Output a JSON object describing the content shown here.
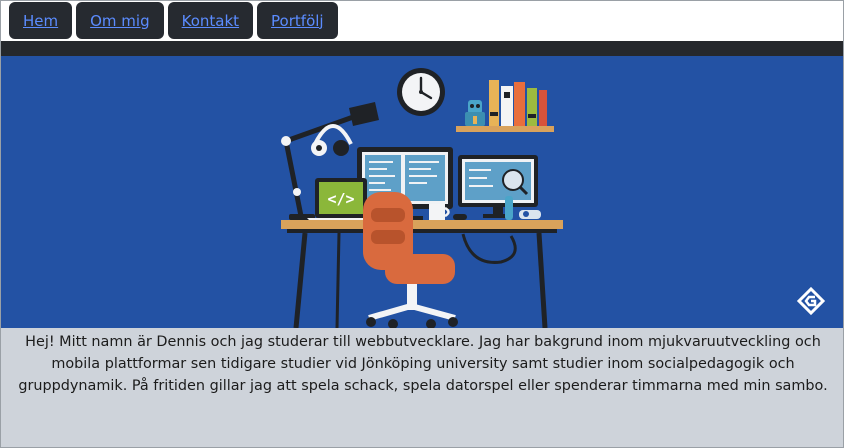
{
  "nav": {
    "items": [
      {
        "label": "Hem"
      },
      {
        "label": "Om mig"
      },
      {
        "label": "Kontakt"
      },
      {
        "label": "Portfölj"
      }
    ]
  },
  "hero": {
    "illustration": "workspace-desk-illustration",
    "laptop_code_text": "</>",
    "colors": {
      "background": "#2352a4",
      "nav_button": "#262a30",
      "link": "#5b8cff",
      "bio_background": "#ced3da"
    }
  },
  "bio": {
    "text": "Hej! Mitt namn är Dennis och jag studerar till webbutvecklare. Jag har bakgrund inom mjukvaruutveckling och mobila plattformar sen tidigare studier vid Jönköping university samt studier inom socialpedagogik och gruppdynamik. På fritiden gillar jag att spela schack, spela datorspel eller spenderar timmarna med min sambo."
  }
}
